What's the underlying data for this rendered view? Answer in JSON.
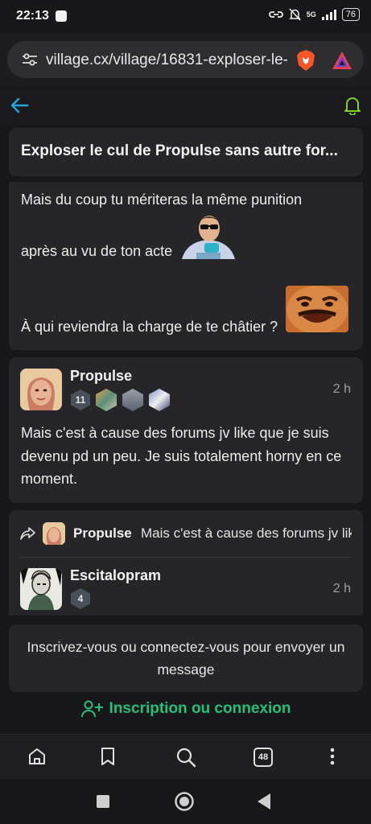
{
  "status_bar": {
    "time": "22:13",
    "network": "5G",
    "battery": "76"
  },
  "browser": {
    "url": "village.cx/village/16831-exploser-le-",
    "tab_count": "48"
  },
  "thread": {
    "title": "Exploser le cul de Propulse sans autre for..."
  },
  "message1": {
    "line1": "Mais du coup tu mériteras la même punition",
    "line2": "après au vu de ton acte",
    "line3": "À qui reviendra la charge de te châtier ?"
  },
  "message2": {
    "username": "Propulse",
    "level": "11",
    "time": "2 h",
    "text": "Mais c'est à cause des forums jv like que je suis devenu pd un peu. Je suis totalement horny en ce moment."
  },
  "message3": {
    "reply_user": "Propulse",
    "reply_snippet": "Mais c'est à cause des forums jv like que je suis",
    "username": "Escitalopram",
    "level": "4",
    "time": "2 h"
  },
  "login": {
    "prompt": "Inscrivez-vous ou connectez-vous pour envoyer un message",
    "signup_label": "Inscription ou connexion"
  },
  "colors": {
    "accent_green": "#22c07a",
    "back_arrow_blue": "#29a3d6",
    "bell_green": "#7ed321",
    "card_bg": "#262629",
    "page_bg": "#18181a"
  }
}
